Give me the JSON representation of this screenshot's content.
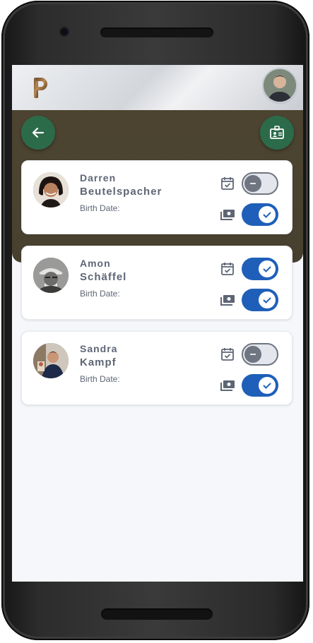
{
  "app": {
    "logo_icon": "app-logo-p",
    "user_avatar_icon": "user-avatar"
  },
  "actions": {
    "back_icon": "arrow-left-icon",
    "badge_icon": "id-badge-icon"
  },
  "people": [
    {
      "first_name": "Darren",
      "last_name": "Beutelspacher",
      "birth_date_label": "Birth Date:",
      "calendar_enabled": false,
      "payment_enabled": true
    },
    {
      "first_name": "Amon",
      "last_name": "Schäffel",
      "birth_date_label": "Birth Date:",
      "calendar_enabled": true,
      "payment_enabled": true
    },
    {
      "first_name": "Sandra",
      "last_name": "Kampf",
      "birth_date_label": "Birth Date:",
      "calendar_enabled": false,
      "payment_enabled": true
    }
  ],
  "colors": {
    "toggle_on": "#1f5fb9",
    "fab": "#2c6b4a",
    "hero": "#4a4330"
  }
}
